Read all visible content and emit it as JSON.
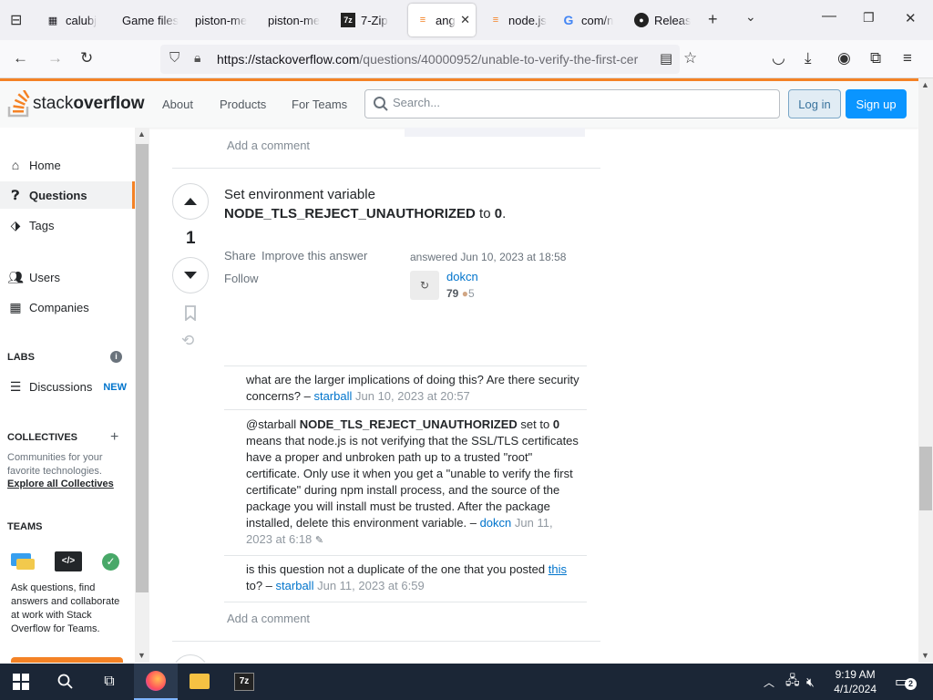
{
  "browser": {
    "tabs": [
      {
        "label": "calubj",
        "icon": "file-icon"
      },
      {
        "label": "Game files",
        "icon": ""
      },
      {
        "label": "piston-me",
        "icon": ""
      },
      {
        "label": "piston-me",
        "icon": ""
      },
      {
        "label": "7-Zip",
        "icon": "7zip-icon"
      },
      {
        "label": "ang",
        "icon": "stackoverflow-icon",
        "active": true
      },
      {
        "label": "node.js",
        "icon": "stackoverflow-icon"
      },
      {
        "label": "com/n",
        "icon": "google-icon"
      },
      {
        "label": "Releas",
        "icon": "github-icon"
      }
    ],
    "url_host": "https://stackoverflow.com",
    "url_path": "/questions/40000952/unable-to-verify-the-first-cer"
  },
  "so": {
    "logo_light": "stack",
    "logo_bold": "overflow",
    "nav": {
      "about": "About",
      "products": "Products",
      "teams": "For Teams"
    },
    "search_placeholder": "Search...",
    "login": "Log in",
    "signup": "Sign up",
    "accent": "#f48225",
    "brand_blue": "#0a95ff"
  },
  "sidebar": {
    "home": "Home",
    "questions": "Questions",
    "tags": "Tags",
    "users": "Users",
    "companies": "Companies",
    "labs": "LABS",
    "discussions": "Discussions",
    "new_badge": "NEW",
    "collectives": "COLLECTIVES",
    "collectives_desc": "Communities for your favorite technologies.",
    "explore": "Explore all Collectives",
    "teams": "TEAMS",
    "teams_desc": "Ask questions, find answers and collaborate at work with Stack Overflow for Teams."
  },
  "answer": {
    "prev_add_comment": "Add a comment",
    "vote_count": "1",
    "text_1": "Set environment variable",
    "env_var": "NODE_TLS_REJECT_UNAUTHORIZED",
    "text_2": " to ",
    "value": "0",
    "text_3": ".",
    "share": "Share",
    "improve": "Improve this answer",
    "follow": "Follow",
    "answered": "answered Jun 10, 2023 at 18:58",
    "user": "dokcn",
    "rep": "79",
    "bronze": "5"
  },
  "comments": [
    {
      "text": "what are the larger implications of doing this? Are there security concerns? –",
      "user": "starball",
      "time": "Jun 10, 2023 at 20:57"
    },
    {
      "prefix": "@starball ",
      "code": "NODE_TLS_REJECT_UNAUTHORIZED",
      "mid": " set to ",
      "val": "0",
      "text": " means that node.js is not verifying that the SSL/TLS certificates have a proper and unbroken path up to a trusted \"root\" certificate. Only use it when you get a \"unable to verify the first certificate\" during npm install process, and the source of the package you will install must be trusted. After the package installed, delete this environment variable. –",
      "user": "dokcn",
      "time": "Jun 11, 2023 at 6:18"
    },
    {
      "text": "is this question not a duplicate of the one that you posted ",
      "link": "this",
      "text2": " to? –",
      "user": "starball",
      "time": "Jun 11, 2023 at 6:59"
    }
  ],
  "add_comment": "Add a comment",
  "taskbar": {
    "time": "9:19 AM",
    "date": "4/1/2024",
    "notifications": "2"
  }
}
